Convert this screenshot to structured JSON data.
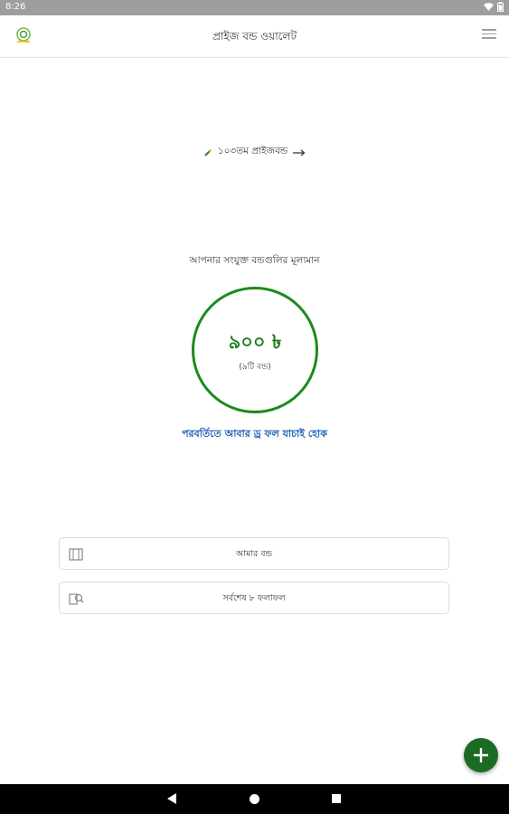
{
  "status_bar": {
    "time": "8:26",
    "icons": [
      "wifi-icon",
      "battery-icon"
    ]
  },
  "app_bar": {
    "title": "প্রাইজ বন্ড ওয়ালেট",
    "logo_icon": "app-logo-icon",
    "menu_icon": "menu-icon"
  },
  "draw_link": {
    "label": "১০৩তম প্রাইজবন্ড",
    "icon": "sparkle-icon",
    "arrow_icon": "arrow-right-icon"
  },
  "summary": {
    "label": "আপনার সংযুক্ত বন্ডগুলির মূল্যমান",
    "amount": "৯০০ ৳",
    "count": "(৯টি বন্ড)",
    "check_link": "পরবর্তিতে আবার ড্র ফল যাচাই হোক",
    "accent_color": "#1f8a1f",
    "link_color": "#1a5fb4"
  },
  "actions": [
    {
      "label": "আমার বন্ড",
      "icon": "bond-book-icon"
    },
    {
      "label": "সর্বশেষ ৮ ফলাফল",
      "icon": "result-search-icon"
    }
  ],
  "fab": {
    "icon": "plus-icon",
    "color": "#1b6b24"
  },
  "nav_bar": {
    "icons": [
      "back-icon",
      "home-icon",
      "recents-icon"
    ]
  }
}
